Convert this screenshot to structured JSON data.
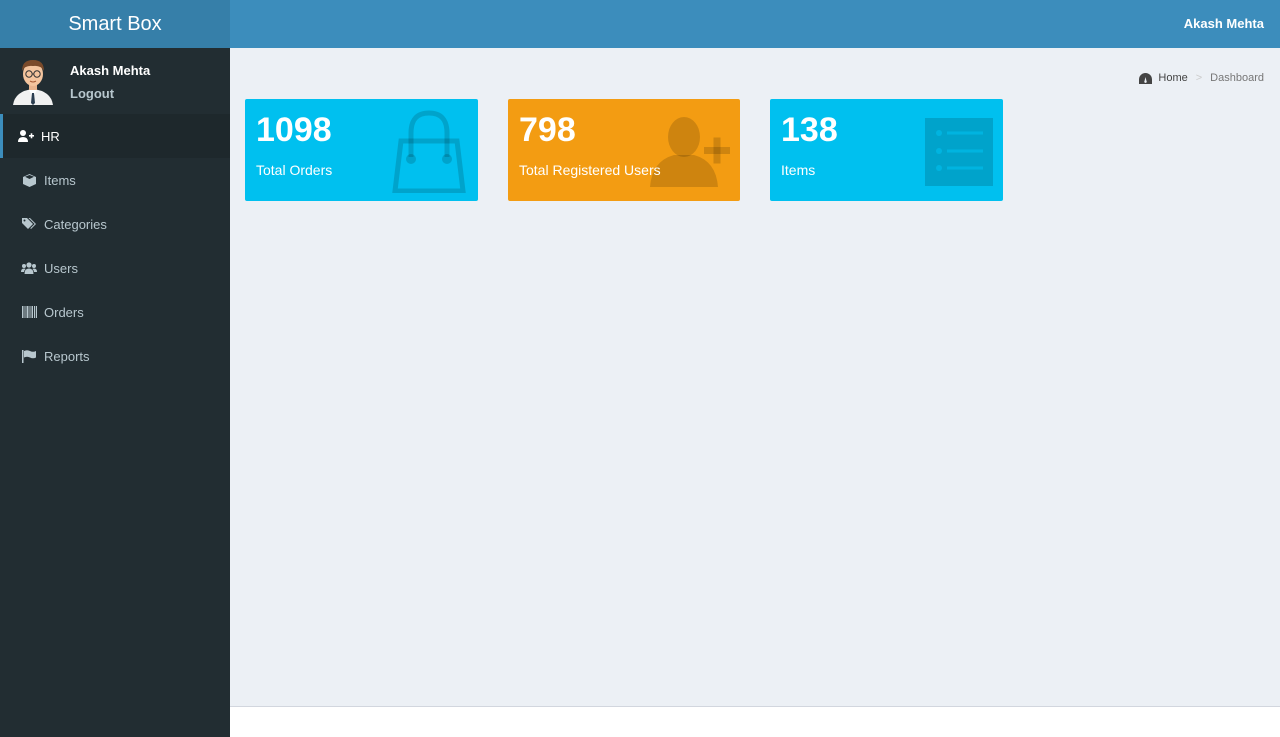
{
  "app": {
    "title": "Smart Box"
  },
  "header": {
    "user_name": "Akash Mehta"
  },
  "sidebar": {
    "user": {
      "name": "Akash Mehta",
      "logout_label": "Logout"
    },
    "items": [
      {
        "label": "HR",
        "icon": "user-plus-icon",
        "active": true
      },
      {
        "label": "Items",
        "icon": "cube-icon"
      },
      {
        "label": "Categories",
        "icon": "tags-icon"
      },
      {
        "label": "Users",
        "icon": "users-icon"
      },
      {
        "label": "Orders",
        "icon": "barcode-icon"
      },
      {
        "label": "Reports",
        "icon": "flag-icon"
      }
    ]
  },
  "breadcrumb": {
    "home": "Home",
    "current": "Dashboard"
  },
  "stats": [
    {
      "value": "1098",
      "label": "Total Orders",
      "color": "#00c0ef",
      "icon": "shopping-bag-icon"
    },
    {
      "value": "798",
      "label": "Total Registered Users",
      "color": "#f39c12",
      "icon": "person-add-icon"
    },
    {
      "value": "138",
      "label": "Items",
      "color": "#00c0ef",
      "icon": "list-icon"
    }
  ],
  "colors": {
    "header": "#3c8dbc",
    "logo": "#367fa9",
    "sidebar": "#222d32",
    "content": "#ecf0f5"
  }
}
